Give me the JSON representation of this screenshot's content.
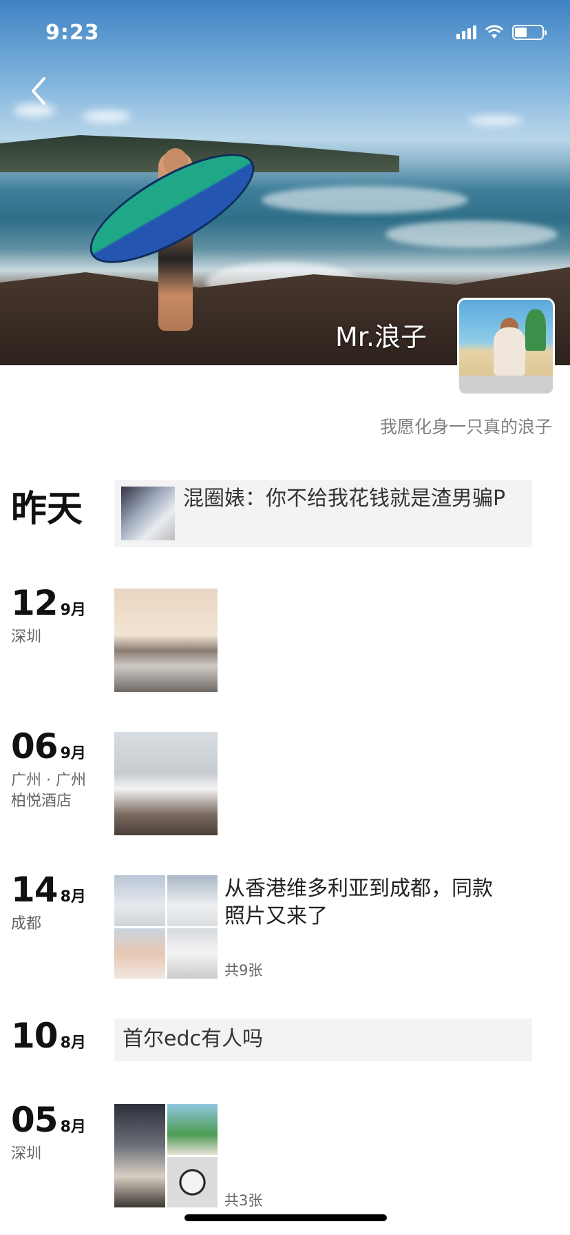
{
  "status_bar": {
    "time": "9:23",
    "battery_level": 0.45
  },
  "profile": {
    "name": "Mr.浪子",
    "signature": "我愿化身一只真的浪子"
  },
  "colors": {
    "card_bg": "#f3f3f5",
    "secondary_text": "#808080"
  },
  "timeline": [
    {
      "date": "昨天",
      "type": "text_with_thumb",
      "text": "混圈婊：你不给我花钱就是渣男骗P"
    },
    {
      "day": "12",
      "month": "9月",
      "location": "深圳",
      "type": "photo"
    },
    {
      "day": "06",
      "month": "9月",
      "location_line1": "广州 · 广州",
      "location_line2": "柏悦酒店",
      "type": "photo"
    },
    {
      "day": "14",
      "month": "8月",
      "location": "成都",
      "type": "photo_grid",
      "text_line1": "从香港维多利亚到成都，同款",
      "text_line2": "照片又来了",
      "count": "共9张"
    },
    {
      "day": "10",
      "month": "8月",
      "type": "text",
      "text": "首尔edc有人吗"
    },
    {
      "day": "05",
      "month": "8月",
      "location": "深圳",
      "type": "photo_grid",
      "count": "共3张"
    }
  ],
  "icons": {
    "back": "chevron-left-icon",
    "signal": "cellular-signal-icon",
    "wifi": "wifi-icon",
    "battery": "battery-icon"
  }
}
